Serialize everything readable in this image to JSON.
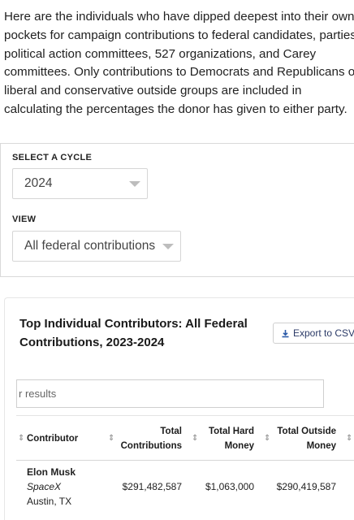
{
  "intro": {
    "text": "Here are the individuals who have dipped deepest into their own pockets for campaign contributions to federal candidates, parties, political action committees, 527 organizations, and Carey committees. Only contributions to Democrats and Republicans or liberal and conservative outside groups are included in calculating the percentages the donor has given to either party."
  },
  "filters": {
    "cycle_label": "SELECT A CYCLE",
    "cycle_value": "2024",
    "view_label": "VIEW",
    "view_value": "All federal contributions"
  },
  "table": {
    "title": "Top Individual Contributors: All Federal Contributions, 2023-2024",
    "export_label": "Export to CSV",
    "search_placeholder": "r results",
    "columns": [
      {
        "label": "Contributor"
      },
      {
        "label": "Total Contributions"
      },
      {
        "label": "Total Hard Money"
      },
      {
        "label": "Total Outside Money"
      }
    ],
    "rows": [
      {
        "name": "Elon Musk",
        "employer": "SpaceX",
        "location": "Austin, TX",
        "total": "$291,482,587",
        "hard": "$1,063,000",
        "outside": "$290,419,587"
      }
    ]
  },
  "icons": {
    "export": "download-icon",
    "sort": "sort-arrows-icon",
    "dropdown": "chevron-down-icon"
  },
  "colors": {
    "export_text": "#2b3a67",
    "border": "#d6d6d6"
  }
}
